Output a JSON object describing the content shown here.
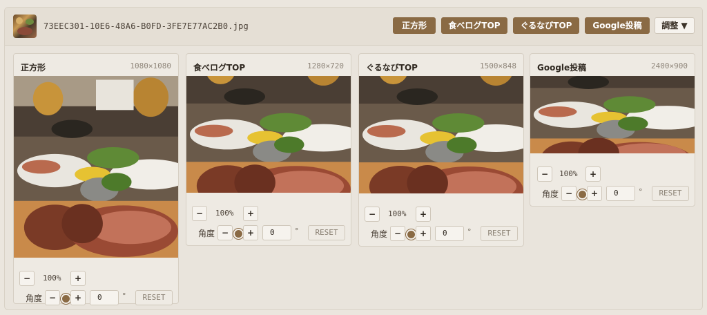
{
  "file": {
    "name": "73EEC301-10E6-48A6-B0FD-3FE7E77AC2B0.jpg"
  },
  "toolbar": {
    "presets": [
      "正方形",
      "食べログTOP",
      "ぐるなびTOP",
      "Google投稿"
    ],
    "adjust_label": "調整",
    "adjust_arrow": "▼"
  },
  "cards": [
    {
      "title": "正方形",
      "dims": "1080×1080",
      "zoom": "100%",
      "angle_label": "角度",
      "angle": "0",
      "deg": "°",
      "reset": "RESET"
    },
    {
      "title": "食べログTOP",
      "dims": "1280×720",
      "zoom": "100%",
      "angle_label": "角度",
      "angle": "0",
      "deg": "°",
      "reset": "RESET"
    },
    {
      "title": "ぐるなびTOP",
      "dims": "1500×848",
      "zoom": "100%",
      "angle_label": "角度",
      "angle": "0",
      "deg": "°",
      "reset": "RESET"
    },
    {
      "title": "Google投稿",
      "dims": "2400×900",
      "zoom": "100%",
      "angle_label": "角度",
      "angle": "0",
      "deg": "°",
      "reset": "RESET"
    }
  ],
  "controls": {
    "minus": "−",
    "plus": "+"
  },
  "colors": {
    "accent": "#8a6a44",
    "background": "#ebe6de"
  },
  "icons": {
    "adjust": "caret-down-icon",
    "rotate": "rotation-knob-icon",
    "thumbnail": "image-thumbnail"
  }
}
